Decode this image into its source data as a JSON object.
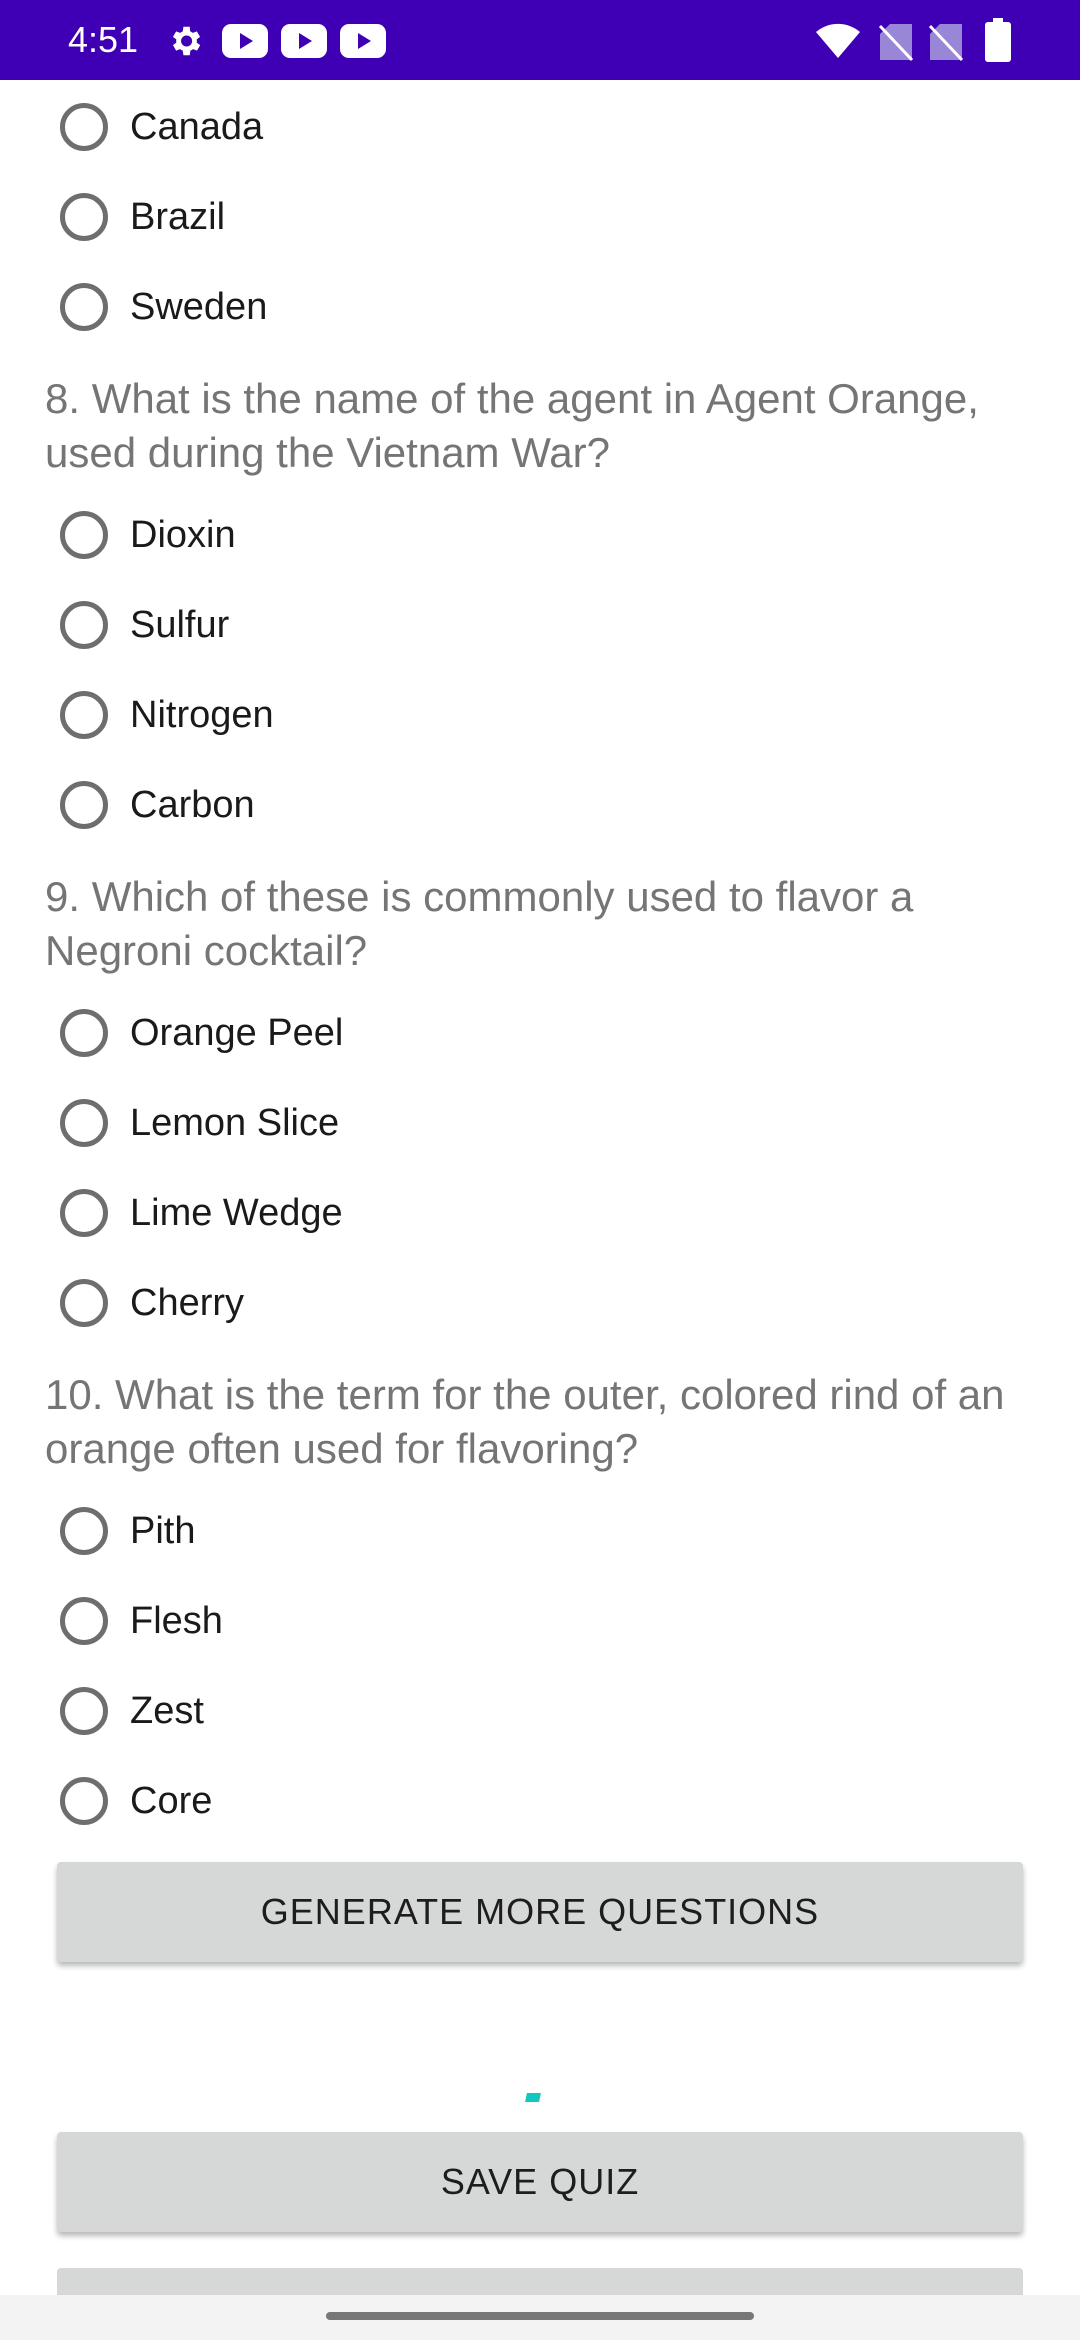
{
  "status_bar": {
    "time": "4:51",
    "icons": [
      "settings-icon",
      "youtube-icon",
      "youtube-icon",
      "youtube-icon",
      "wifi-icon",
      "no-sim-icon",
      "no-sim-icon",
      "battery-icon"
    ],
    "background": "#3f00b5"
  },
  "quiz": {
    "q7_options": [
      "Canada",
      "Brazil",
      "Sweden"
    ],
    "questions": [
      {
        "text": "8. What is the name of the agent in Agent Orange, used during the Vietnam War?",
        "options": [
          "Dioxin",
          "Sulfur",
          "Nitrogen",
          "Carbon"
        ]
      },
      {
        "text": "9. Which of these is commonly used to flavor a Negroni cocktail?",
        "options": [
          "Orange Peel",
          "Lemon Slice",
          "Lime Wedge",
          "Cherry"
        ]
      },
      {
        "text": "10. What is the term for the outer, colored rind of an orange often used for flavoring?",
        "options": [
          "Pith",
          "Flesh",
          "Zest",
          "Core"
        ]
      }
    ]
  },
  "buttons": {
    "generate_label": "GENERATE MORE QUESTIONS",
    "save_label": "SAVE QUIZ"
  },
  "colors": {
    "accent_spinner": "#10c8c0",
    "button_bg": "#d6d7d7",
    "question_text": "#757575"
  }
}
